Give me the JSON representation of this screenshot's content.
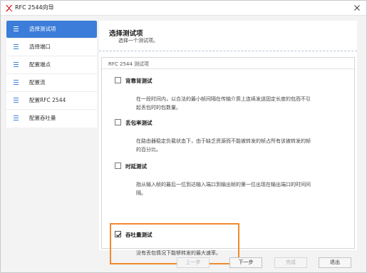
{
  "window": {
    "title": "RFC 2544向导"
  },
  "sidebar": {
    "items": [
      {
        "label": "选择测试项",
        "active": true
      },
      {
        "label": "选择端口",
        "active": false
      },
      {
        "label": "配置端点",
        "active": false
      },
      {
        "label": "配置流",
        "active": false
      },
      {
        "label": "配置RFC 2544",
        "active": false
      },
      {
        "label": "配置吞吐量",
        "active": false
      }
    ]
  },
  "main": {
    "title": "选择测试项",
    "subtitle": "选择一个测试项。",
    "group_title": "RFC 2544 测试项",
    "options": [
      {
        "label": "背靠背测试",
        "checked": false,
        "desc_lines": [
          "在一段时间内，以合法的最小帧间隔在传输介质上连续发送固定长度的包而不引",
          "起丢包时的包数量。"
        ]
      },
      {
        "label": "丢包率测试",
        "checked": false,
        "desc_lines": [
          "在路由器稳定负载状态下，由于缺乏资源而不能被转发的帧占所有该被转发的帧",
          "的百分比。"
        ]
      },
      {
        "label": "时延测试",
        "checked": false,
        "desc_lines": [
          "指从输入帧的最后一位到达输入端口到输出帧的第一位出现在输出端口的时间间",
          "隔。"
        ]
      },
      {
        "label": "吞吐量测试",
        "checked": true,
        "desc_lines": [
          "没有丢包情况下能够转发的最大速率。"
        ]
      }
    ]
  },
  "footer": {
    "prev": "上一步",
    "next": "下一步",
    "finish": "完成",
    "exit": "退出"
  },
  "colors": {
    "accent": "#3b7dd8",
    "highlight": "#f08a2c"
  },
  "icons": {
    "app": "brand-x-icon",
    "close": "close-icon",
    "nav": "menu-lines-icon",
    "check": "checkmark-icon"
  }
}
